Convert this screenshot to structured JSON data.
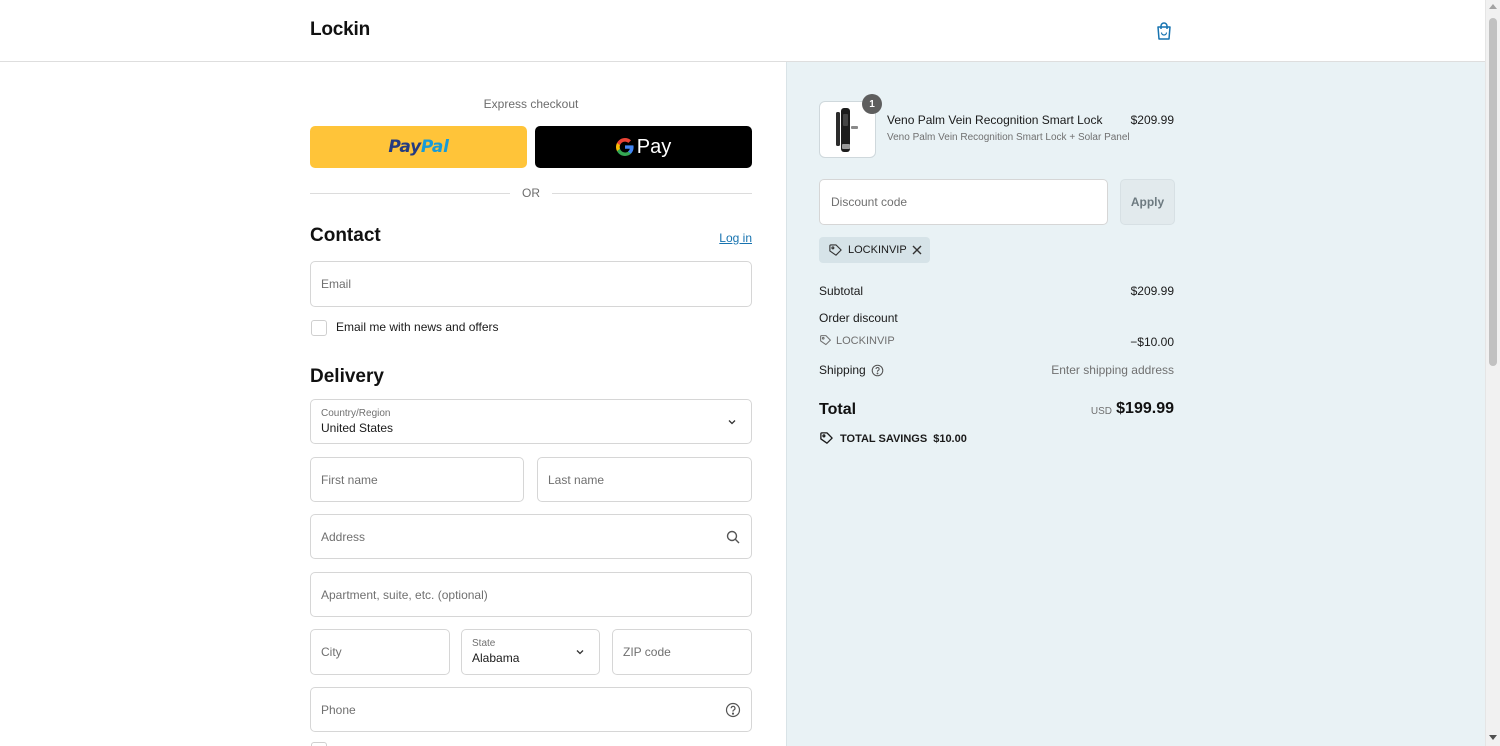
{
  "header": {
    "logo": "Lockin",
    "cart_icon": "shopping-bag-icon"
  },
  "express": {
    "label": "Express checkout",
    "paypal_part1": "Pay",
    "paypal_part2": "Pal",
    "gpay_label": "Pay",
    "or_label": "OR"
  },
  "contact": {
    "title": "Contact",
    "login_label": "Log in",
    "email_placeholder": "Email",
    "newsletter_label": "Email me with news and offers",
    "newsletter_checked": false
  },
  "delivery": {
    "title": "Delivery",
    "country_label": "Country/Region",
    "country_value": "United States",
    "first_name_placeholder": "First name",
    "last_name_placeholder": "Last name",
    "address_placeholder": "Address",
    "apartment_placeholder": "Apartment, suite, etc. (optional)",
    "city_placeholder": "City",
    "state_label": "State",
    "state_value": "Alabama",
    "zip_placeholder": "ZIP code",
    "phone_placeholder": "Phone"
  },
  "summary": {
    "product": {
      "quantity": "1",
      "name": "Veno Palm Vein Recognition Smart Lock",
      "variant": "Veno Palm Vein Recognition Smart Lock + Solar Panel",
      "price": "$209.99"
    },
    "discount_placeholder": "Discount code",
    "apply_label": "Apply",
    "applied_code": "LOCKINVIP",
    "subtotal_label": "Subtotal",
    "subtotal_value": "$209.99",
    "order_discount_label": "Order discount",
    "discount_code": "LOCKINVIP",
    "discount_value": "−$10.00",
    "shipping_label": "Shipping",
    "shipping_value": "Enter shipping address",
    "total_label": "Total",
    "currency": "USD",
    "total_value": "$199.99",
    "savings_label": "TOTAL SAVINGS",
    "savings_value": "$10.00"
  },
  "colors": {
    "paypal_yellow": "#ffc439",
    "link_blue": "#1773b0",
    "summary_bg": "#e9f2f5"
  }
}
